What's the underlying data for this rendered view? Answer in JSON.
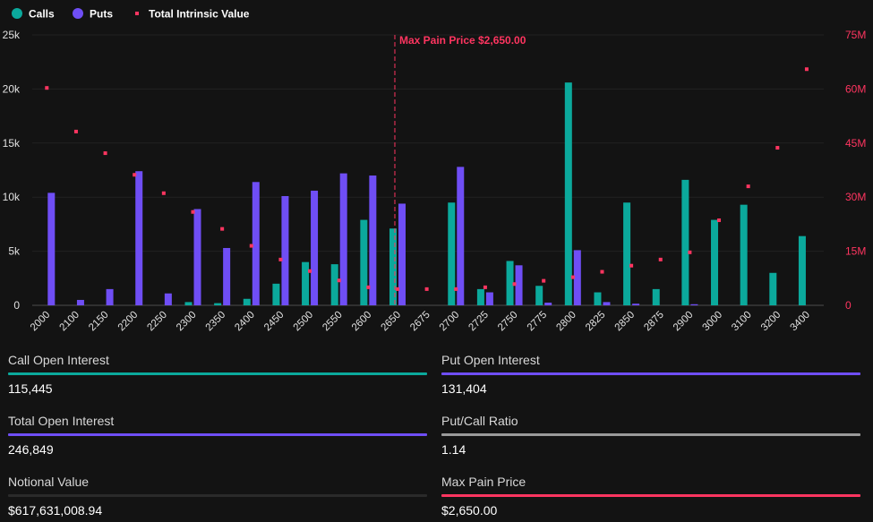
{
  "colors": {
    "calls": "#0ba99c",
    "puts": "#6f4ef5",
    "tiv": "#ff3560",
    "grey": "#9a9a9a",
    "dark": "#2a2a2a"
  },
  "chart_data": {
    "type": "bar",
    "title": "",
    "legend": {
      "position": "top-left",
      "entries": [
        "Calls",
        "Puts",
        "Total Intrinsic Value"
      ]
    },
    "categories": [
      "2000",
      "2100",
      "2150",
      "2200",
      "2250",
      "2300",
      "2350",
      "2400",
      "2450",
      "2500",
      "2550",
      "2600",
      "2650",
      "2675",
      "2700",
      "2725",
      "2750",
      "2775",
      "2800",
      "2825",
      "2850",
      "2875",
      "2900",
      "3000",
      "3100",
      "3200",
      "3400"
    ],
    "series": [
      {
        "name": "Calls",
        "axis": "left",
        "values": [
          0,
          0,
          0,
          0,
          0,
          0.3,
          0.2,
          0.6,
          2.0,
          4.0,
          3.8,
          7.9,
          7.1,
          0,
          9.5,
          1.5,
          4.1,
          1.8,
          20.6,
          1.2,
          9.5,
          1.5,
          11.6,
          7.9,
          9.3,
          3.0,
          6.4
        ]
      },
      {
        "name": "Puts",
        "axis": "left",
        "values": [
          10.4,
          0.5,
          1.5,
          12.4,
          1.1,
          8.9,
          5.3,
          11.4,
          10.1,
          10.6,
          12.2,
          12.0,
          9.4,
          0,
          12.8,
          1.2,
          3.7,
          0.25,
          5.1,
          0.3,
          0.15,
          0,
          0.1,
          0,
          0,
          0,
          0
        ]
      },
      {
        "name": "Total Intrinsic Value",
        "axis": "right",
        "type": "scatter",
        "values": [
          60.3,
          48.2,
          42.2,
          36.2,
          31.1,
          25.9,
          21.2,
          16.5,
          12.7,
          9.5,
          6.9,
          5.0,
          4.5,
          4.5,
          4.5,
          5.0,
          5.9,
          6.8,
          7.8,
          9.3,
          11.0,
          12.7,
          14.7,
          23.6,
          33.0,
          43.7,
          65.5
        ]
      }
    ],
    "y_left": {
      "unit": "thousand contracts",
      "range": [
        0,
        25
      ],
      "ticks": [
        "0",
        "5k",
        "10k",
        "15k",
        "20k",
        "25k"
      ]
    },
    "y_right": {
      "unit": "million USD",
      "range": [
        0,
        75
      ],
      "ticks": [
        "0",
        "15M",
        "30M",
        "45M",
        "60M",
        "75M"
      ]
    },
    "annotation": {
      "category": "2650",
      "label": "Max Pain Price $2,650.00"
    },
    "grid": true
  },
  "stats": [
    {
      "label": "Call Open Interest",
      "value": "115,445",
      "color": "#0ba99c"
    },
    {
      "label": "Put Open Interest",
      "value": "131,404",
      "color": "#6f4ef5"
    },
    {
      "label": "Total Open Interest",
      "value": "246,849",
      "color": "#6f4ef5"
    },
    {
      "label": "Put/Call Ratio",
      "value": "1.14",
      "color": "#9a9a9a"
    },
    {
      "label": "Notional Value",
      "value": "$617,631,008.94",
      "color": "#2a2a2a"
    },
    {
      "label": "Max Pain Price",
      "value": "$2,650.00",
      "color": "#ff3560"
    }
  ]
}
